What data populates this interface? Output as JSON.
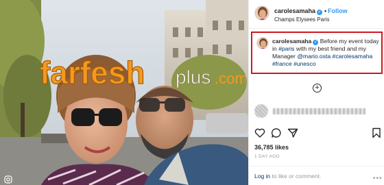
{
  "post": {
    "username": "carolesamaha",
    "follow_label": "Follow",
    "location": "Champs Elysees Paris",
    "verified_glyph": "✓",
    "separator": "•"
  },
  "caption": {
    "username": "carolesamaha",
    "text_1": " Before my event today in ",
    "tag_paris": "#paris",
    "text_2": " with my best friend and my Manager ",
    "mention": "@mario.osta",
    "text_3": " ",
    "tag_1": "#carolesamaha",
    "tag_2": "#france",
    "tag_3": "#unesco"
  },
  "add_comment_glyph": "+",
  "likes": "36,785 likes",
  "time_ago": "1 DAY AGO",
  "login_prompt": {
    "link": "Log in",
    "rest": " to like or comment.",
    "more": "•••"
  },
  "watermark": {
    "brand_main": "farfesh",
    "brand_suffix": "plus",
    "brand_tld": ".com"
  },
  "icons": [
    "heart-icon",
    "comment-icon",
    "share-icon",
    "bookmark-icon",
    "add-comment-icon",
    "verified-icon",
    "watermark-logo-icon"
  ],
  "colors": {
    "follow_blue": "#3897f0",
    "highlight_red": "#d0161d",
    "link_navy": "#003569",
    "watermark_orange": "#f29a1f"
  }
}
